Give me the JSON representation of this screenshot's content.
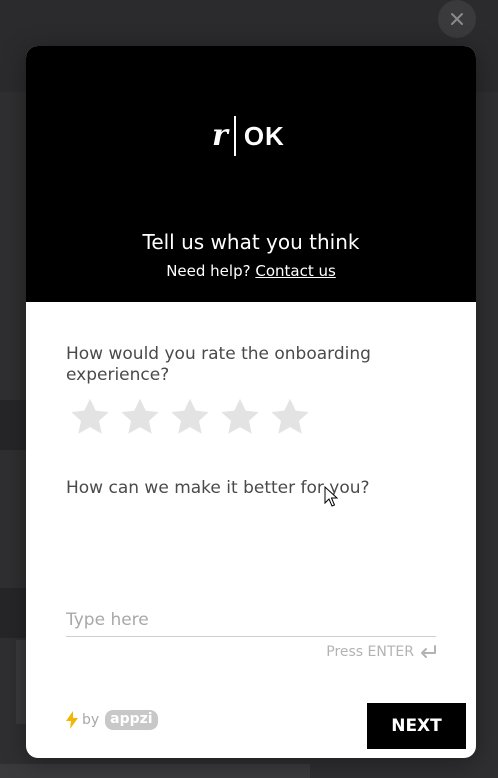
{
  "logo": {
    "left_text": "r",
    "right_text": "OK"
  },
  "header": {
    "title": "Tell us what you think",
    "help_prefix": "Need help?",
    "help_link": "Contact us"
  },
  "questions": {
    "rating_label": "How would you rate the onboarding experience?",
    "rating_max": 5,
    "rating_value": 0,
    "improve_label": "How can we make it better for you?"
  },
  "answer": {
    "placeholder": "Type here",
    "value": ""
  },
  "hint": {
    "press_enter": "Press ENTER"
  },
  "footer": {
    "by_text": "by",
    "brand": "appzi",
    "next_label": "NEXT"
  },
  "icons": {
    "close": "close-icon",
    "star": "star-icon",
    "enter": "enter-icon",
    "bolt": "lightning-icon"
  },
  "colors": {
    "header_bg": "#000000",
    "star_empty": "#e3e3e3",
    "bolt": "#f2b705",
    "next_bg": "#000000"
  }
}
